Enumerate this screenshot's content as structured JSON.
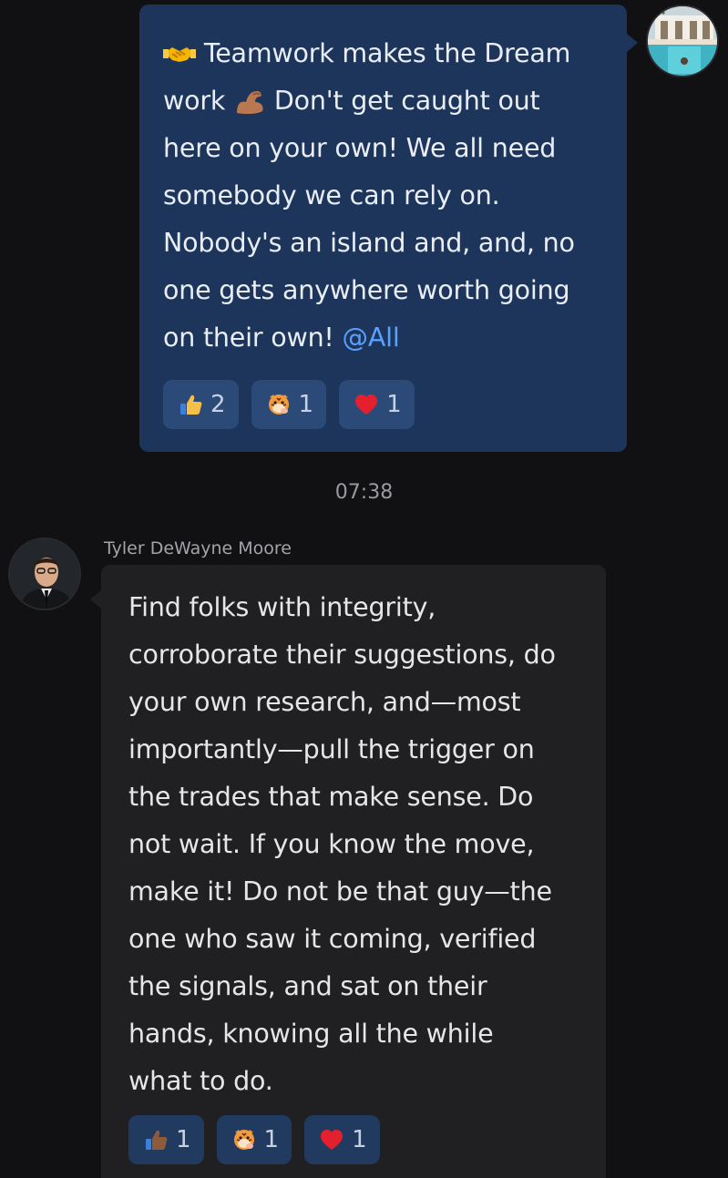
{
  "outgoing": {
    "avatar_icon": "resort-pool-avatar",
    "text_before": "Teamwork makes the Dream\nwork ",
    "text_after": " Don't get caught out\nhere on your own! We all need\nsomebody we can rely on.\nNobody's an island and, and, no\none gets anywhere worth going\non their own! ",
    "mention": "@All",
    "emoji_start": "handshake-emoji",
    "emoji_mid": "flexed-biceps-emoji",
    "reactions": [
      {
        "icon": "thumbs-up-icon",
        "count": "2"
      },
      {
        "icon": "tiger-sticker-icon",
        "count": "1"
      },
      {
        "icon": "heart-icon",
        "count": "1"
      }
    ],
    "bubble_color": "#1d355b"
  },
  "timestamp": "07:38",
  "incoming": {
    "sender": "Tyler DeWayne Moore",
    "avatar_icon": "man-in-suit-avatar",
    "text": "Find folks with integrity,\ncorroborate their suggestions, do\nyour own research, and—most\nimportantly—pull the trigger on\nthe trades that make sense. Do\nnot wait. If you know the move,\nmake it! Do not be that guy—the\none who saw it coming, verified\nthe signals, and sat on their\nhands, knowing all the while\nwhat to do.",
    "reactions": [
      {
        "icon": "thumbs-up-icon",
        "count": "1"
      },
      {
        "icon": "tiger-sticker-icon",
        "count": "1"
      },
      {
        "icon": "heart-icon",
        "count": "1"
      }
    ],
    "bubble_color": "#202023"
  },
  "colors": {
    "background": "#111113",
    "mention": "#5aa0ff"
  }
}
